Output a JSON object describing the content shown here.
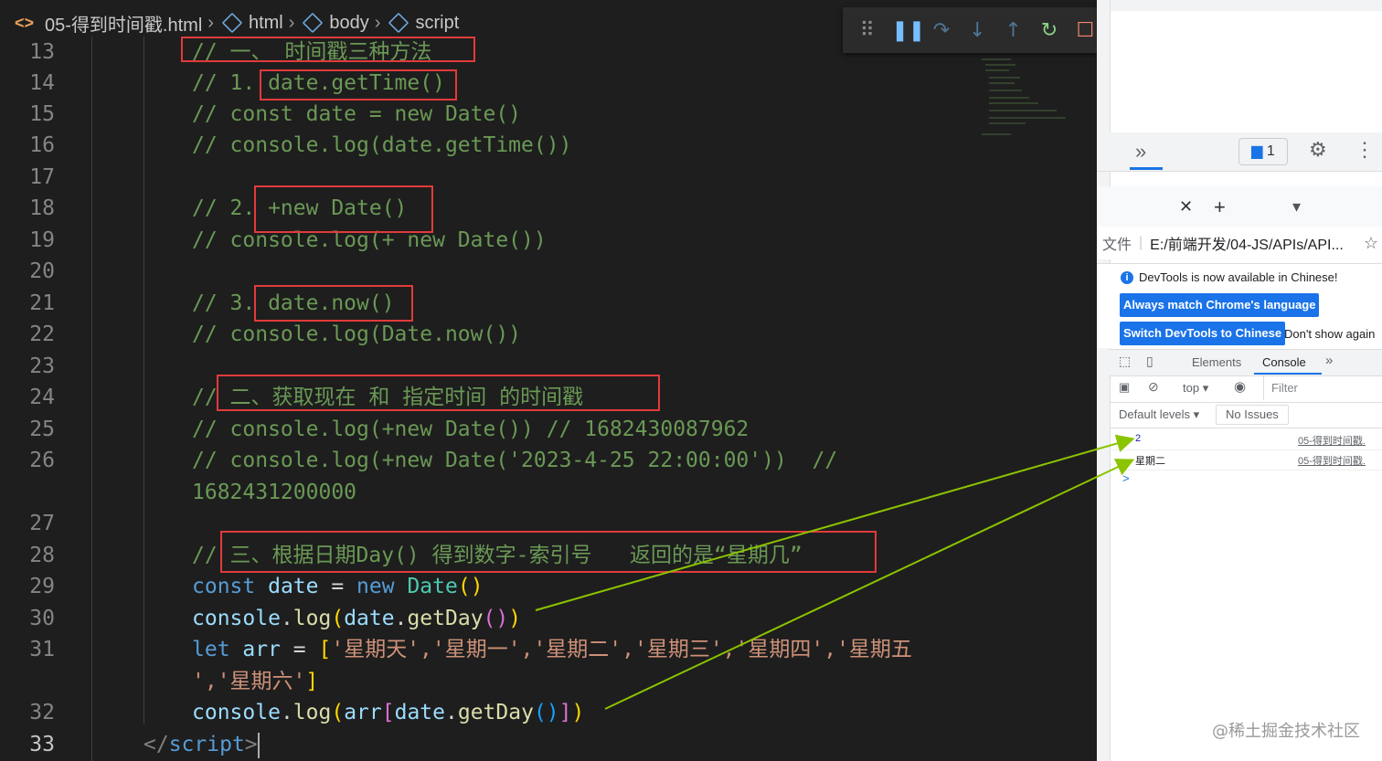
{
  "breadcrumb": {
    "file": "05-得到时间戳.html",
    "items": [
      "html",
      "body",
      "script"
    ]
  },
  "debug_toolbar": {
    "icons": [
      "drag-handle-icon",
      "pause-icon",
      "step-over-icon",
      "step-into-icon",
      "step-out-icon",
      "restart-icon",
      "stop-icon"
    ]
  },
  "line_numbers": [
    "13",
    "14",
    "15",
    "16",
    "17",
    "18",
    "19",
    "20",
    "21",
    "22",
    "23",
    "24",
    "25",
    "26",
    "27",
    "28",
    "29",
    "30",
    "31",
    "32",
    "33"
  ],
  "code": {
    "l13": "// 一、 时间戳三种方法",
    "l14": "// 1. date.getTime()",
    "l15": "// const date = new Date()",
    "l16": "// console.log(date.getTime())",
    "l18": "// 2. +new Date()",
    "l19": "// console.log(+ new Date())",
    "l21": "// 3. date.now()",
    "l22": "// console.log(Date.now())",
    "l24": "// 二、获取现在 和 指定时间 的时间戳",
    "l25": "// console.log(+new Date()) // 1682430087962",
    "l26a": "// console.log(+new Date('2023-4-25 22:00:00'))  //",
    "l26b": "1682431200000",
    "l28": "// 三、根据日期Day() 得到数字-索引号   返回的是“星期几”",
    "l29": {
      "kw": "const",
      "var": "date",
      "eq": " = ",
      "new": "new",
      "cls": "Date",
      "p": "()"
    },
    "l30": {
      "obj": "console",
      "dot": ".",
      "fn": "log",
      "p1": "(",
      "var": "date",
      "fn2": "getDay",
      "p2": "()",
      "p3": ")"
    },
    "l31a": {
      "kw": "let",
      "var": "arr",
      "eq": " = ",
      "b": "[",
      "items": "'星期天','星期一','星期二','星期三','星期四','星期五"
    },
    "l31b": {
      "items": "','星期六'",
      "b": "]"
    },
    "l32": {
      "obj": "console",
      "fn": "log",
      "var": "arr",
      "var2": "date",
      "fn2": "getDay"
    },
    "l33": {
      "open": "</",
      "tag": "script",
      "close": ">"
    }
  },
  "devtools": {
    "badge_count": "1",
    "address_label": "文件",
    "address": "E:/前端开发/04-JS/APIs/API...",
    "info_text": "DevTools is now available in Chinese!",
    "btn_match": "Always match Chrome's language",
    "btn_switch": "Switch DevTools to Chinese",
    "btn_dont_show": "Don't show again",
    "tab_elements": "Elements",
    "tab_console": "Console",
    "context": "top",
    "filter_placeholder": "Filter",
    "default_levels": "Default levels",
    "no_issues": "No Issues",
    "console_rows": [
      {
        "value": "2",
        "source": "05-得到时间戳."
      },
      {
        "value": "星期二",
        "source": "05-得到时间戳."
      }
    ],
    "prompt": ">"
  },
  "watermark": "@稀土掘金技术社区",
  "colors": {
    "annotation_box": "#e23a3a",
    "arrow": "#8bc400",
    "comment": "#6a9955"
  }
}
